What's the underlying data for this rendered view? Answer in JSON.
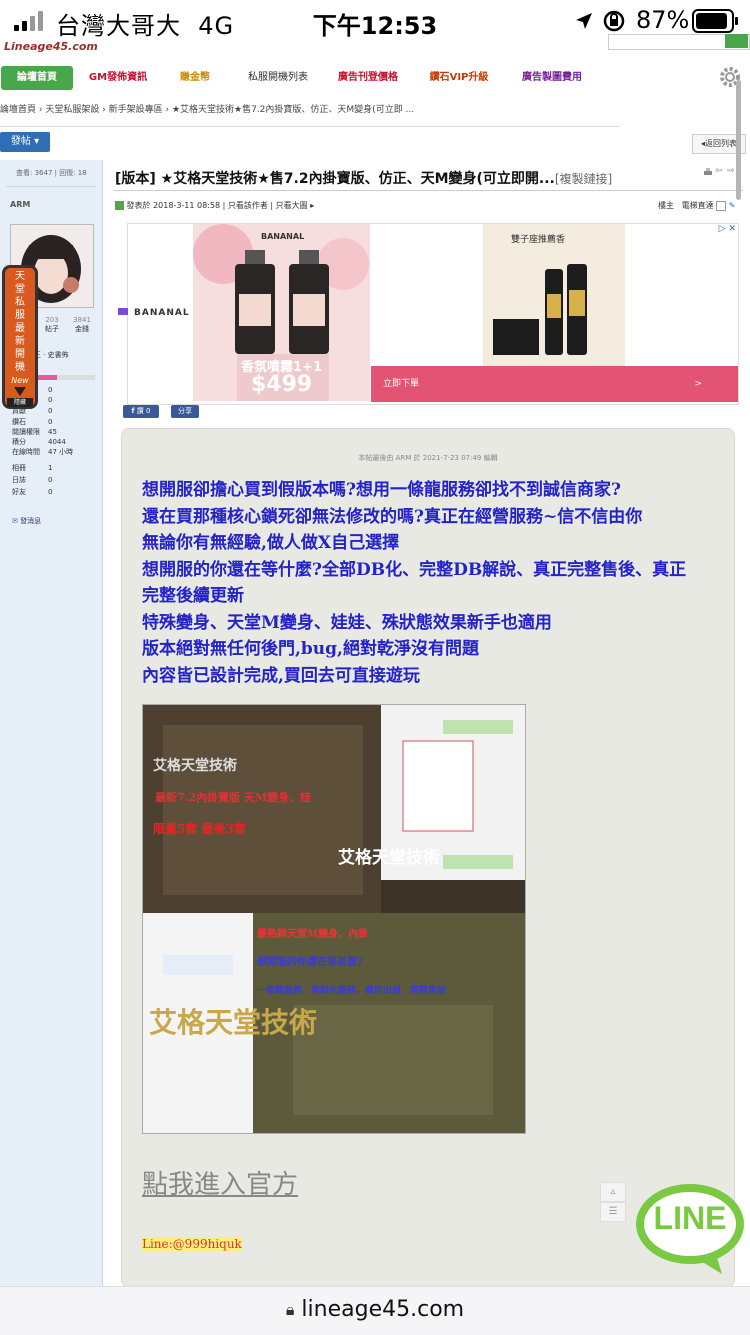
{
  "status": {
    "carrier": "台灣大哥大",
    "network": "4G",
    "time": "下午12:53",
    "battery": "87%"
  },
  "header": {
    "logo_text": "Lineage45.com",
    "nav": [
      {
        "label": "論壇首頁",
        "color": "#ffffff"
      },
      {
        "label": "GM發佈資訊",
        "color": "#c8102e"
      },
      {
        "label": "賺金幣",
        "color": "#c88a00"
      },
      {
        "label": "私服開機列表",
        "color": "#333333"
      },
      {
        "label": "廣告刊登價格",
        "color": "#c8102e"
      },
      {
        "label": "鑽石VIP升級",
        "color": "#c83a00"
      },
      {
        "label": "廣告製圖費用",
        "color": "#7a1f9a"
      }
    ],
    "breadcrumb": "論壇首頁 › 天堂私服架設 › 新手架設專區 › ★艾格天堂技術★售7.2內掛寶版、仿正、天M變身(可立即 ...",
    "post_button": "發帖",
    "back_button": "返回列表"
  },
  "sidebar": {
    "views_label": "查看: 3647 | 回復: 18",
    "username": "ARM",
    "counts": [
      {
        "value": "203",
        "label": "帖子"
      },
      {
        "value": "3841",
        "label": "金錢"
      }
    ],
    "rank": "王 · 史書佈",
    "stats": [
      {
        "label": "",
        "value": "0"
      },
      {
        "label": "",
        "value": "0"
      },
      {
        "label": "貢獻",
        "value": "0"
      },
      {
        "label": "鑽石",
        "value": "0"
      },
      {
        "label": "閱讀權限",
        "value": "45"
      },
      {
        "label": "積分",
        "value": "4044"
      },
      {
        "label": "在線時間",
        "value": "47 小時"
      },
      {
        "label": "相冊",
        "value": "1"
      },
      {
        "label": "日誌",
        "value": "0"
      },
      {
        "label": "好友",
        "value": "0"
      }
    ],
    "message_link": "發消息",
    "side_tab": [
      "天",
      "堂",
      "私",
      "服",
      "最",
      "新",
      "開",
      "機"
    ],
    "side_tab_new": "New",
    "side_tab_hide": "隱藏"
  },
  "post": {
    "title": "[版本] ★艾格天堂技術★售7.2內掛寶版、仿正、天M變身(可立即開...",
    "copy_link": "[複製鏈接]",
    "posted_at": "發表於 2018-3-11 08:58",
    "only_author": "只看該作者",
    "only_big": "只看大圖",
    "sort": "樓主",
    "tv_mode": "電梯直達",
    "share_like": "讚 0",
    "share": "分享",
    "edit_note": "本帖最後由 ARM 於 2021-7-23 07:49 編輯",
    "body_lines": [
      "想開服卻擔心買到假版本嗎?想用一條龍服務卻找不到誠信商家?",
      "還在買那種核心鎖死卻無法修改的嗎?真正在經營服務~信不信由你",
      "無論你有無經驗,做人做X自己選擇",
      "想開服的你還在等什麼?全部DB化、完整DB解說、真正完整售後、真正",
      "完整後續更新",
      "特殊變身、天堂M變身、娃娃、殊狀態效果新手也適用",
      "版本絕對無任何後門,bug,絕對乾淨沒有問題",
      "內容皆已設計完成,買回去可直接遊玩"
    ],
    "promo_texts": [
      "艾格天堂技術",
      "最新7.2內掛寶版 天M變身、娃",
      "限量5套 最後3套",
      "艾格天堂技術",
      "最熱銷天堂M變身、內掛",
      "想開服的你還在等甚麼?",
      "一條龍服務、客製化服務、機房出租、完整售後",
      "艾格天堂技術"
    ],
    "enter_link": "點我進入官方",
    "line_id": "Line:@999hiquk"
  },
  "ad": {
    "brand": "BANANAL",
    "product1": "香氛噴霧1+1",
    "price": "$499",
    "product2": "雙子座推薦香",
    "cta": "立即下單",
    "cta_arrow": ">"
  },
  "line_badge": "LINE",
  "bottom": {
    "url": "lineage45.com"
  }
}
